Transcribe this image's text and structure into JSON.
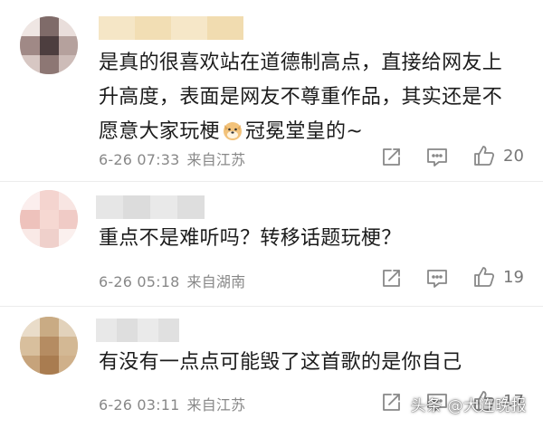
{
  "comments": [
    {
      "text_lines": [
        "是真的很喜欢站在道德制高点，直接给网友上",
        "升高度，表面是网友不尊重作品，其实还是不",
        "愿意大家玩梗"
      ],
      "text_tail": "冠冕堂皇的~",
      "emoji": "doge-emoji",
      "date": "6-26 07:33",
      "location": "来自江苏",
      "likes": "20"
    },
    {
      "text_lines": [
        "重点不是难听吗？转移话题玩梗？"
      ],
      "date": "6-26 05:18",
      "location": "来自湖南",
      "likes": "19"
    },
    {
      "text_lines": [
        "有没有一点点可能毁了这首歌的是你自己"
      ],
      "date": "6-26 03:11",
      "location": "来自江苏",
      "likes": "17"
    }
  ],
  "icons": {
    "share": "share-icon",
    "reply": "reply-icon",
    "like": "thumbs-up-icon"
  },
  "watermark": "头条 @大连晚报",
  "colors": {
    "text": "#1c1c1c",
    "meta": "#888888",
    "divider": "#ececec"
  }
}
